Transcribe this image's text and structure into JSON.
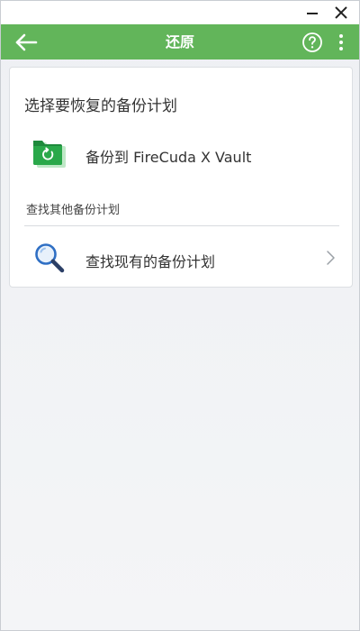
{
  "window": {
    "minimize_icon": "minimize-icon",
    "close_icon": "close-icon"
  },
  "header": {
    "title": "还原",
    "back_icon": "arrow-left-icon",
    "help_icon": "help-circle-icon",
    "more_icon": "more-vertical-icon",
    "bg_color": "#62b55a"
  },
  "card": {
    "section_title": "选择要恢复的备份计划",
    "plan": {
      "label": "备份到 FireCuda X Vault",
      "icon": "backup-folder-icon"
    },
    "other_title": "查找其他备份计划",
    "find": {
      "label": "查找现有的备份计划",
      "icon": "search-icon",
      "chevron_icon": "chevron-right-icon"
    }
  }
}
